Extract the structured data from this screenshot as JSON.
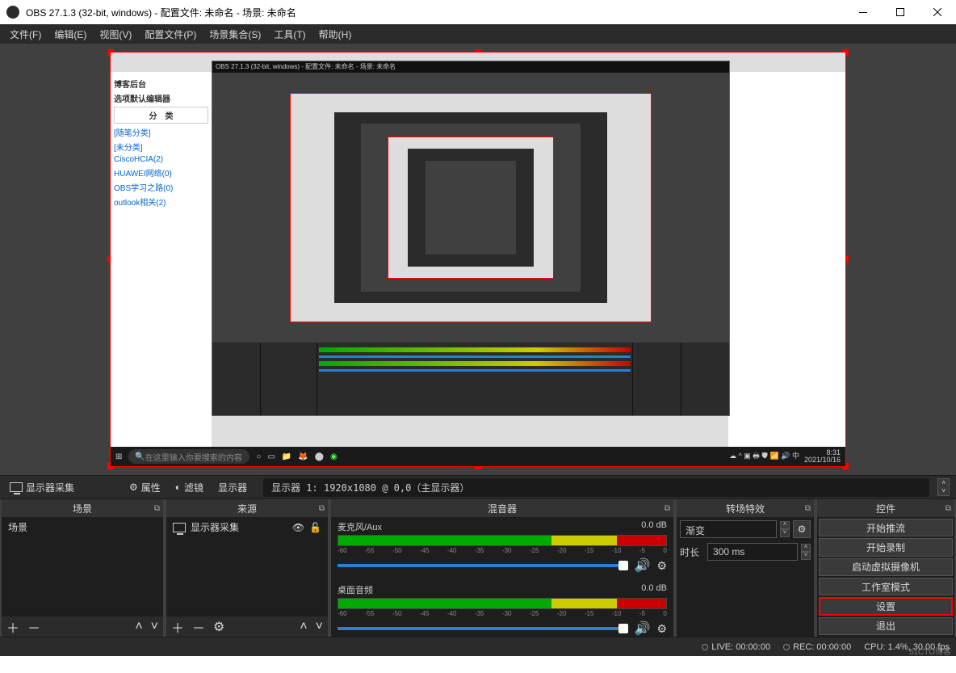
{
  "titlebar": {
    "title": "OBS 27.1.3 (32-bit, windows) - 配置文件: 未命名 - 场景: 未命名"
  },
  "menu": {
    "file": "文件(F)",
    "edit": "编辑(E)",
    "view": "视图(V)",
    "profile": "配置文件(P)",
    "sceneCol": "场景集合(S)",
    "tools": "工具(T)",
    "help": "帮助(H)"
  },
  "sourceBar": {
    "sourceLabel": "显示器采集",
    "properties": "属性",
    "filters": "滤镜",
    "displayLabel": "显示器",
    "displayValue": "显示器 1: 1920x1080 @ 0,0（主显示器）"
  },
  "scenes": {
    "title": "场景",
    "items": [
      "场景"
    ]
  },
  "sources": {
    "title": "来源",
    "items": [
      {
        "name": "显示器采集",
        "visible": true,
        "locked": false
      }
    ]
  },
  "mixer": {
    "title": "混音器",
    "channels": [
      {
        "name": "麦克风/Aux",
        "db": "0.0 dB"
      },
      {
        "name": "桌面音频",
        "db": "0.0 dB"
      }
    ],
    "ticks": [
      "-60",
      "-55",
      "-50",
      "-45",
      "-40",
      "-35",
      "-30",
      "-25",
      "-20",
      "-15",
      "-10",
      "-5",
      "0"
    ]
  },
  "transitions": {
    "title": "转场特效",
    "type": "渐变",
    "durationLabel": "时长",
    "duration": "300 ms"
  },
  "controls": {
    "title": "控件",
    "buttons": {
      "stream": "开始推流",
      "record": "开始录制",
      "vcam": "启动虚拟摄像机",
      "studio": "工作室模式",
      "settings": "设置",
      "exit": "退出"
    }
  },
  "status": {
    "live": "LIVE: 00:00:00",
    "rec": "REC: 00:00:00",
    "cpu": "CPU: 1.4%, 30.00 fps"
  },
  "nested": {
    "searchPlaceholder": "在这里输入你要搜索的内容",
    "time": "8:31",
    "date": "2021/10/16",
    "sidebar": {
      "hdr1": "博客后台",
      "hdr2": "选项默认编辑器",
      "sec": "分　类",
      "l1": "[随笔分类]",
      "l2": "[未分类]",
      "l3": "CiscoHCIA(2)",
      "l4": "HUAWEI网络(0)",
      "l5": "OBS学习之路(0)",
      "l6": "outlook相关(2)"
    },
    "innerTitle": "OBS 27.1.3 (32-bit, windows) - 配置文件: 未命名 - 场景: 未命名"
  },
  "watermark": "51CTO博客"
}
